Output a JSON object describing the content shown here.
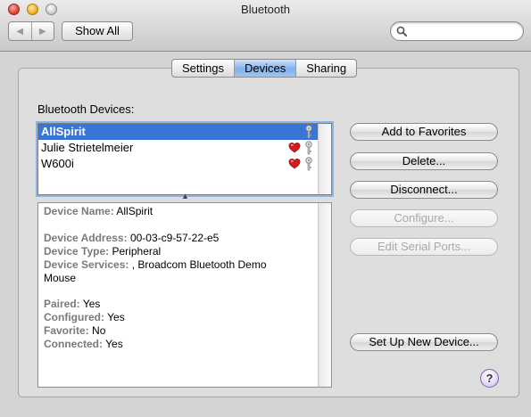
{
  "window": {
    "title": "Bluetooth"
  },
  "toolbar": {
    "back_glyph": "◀",
    "forward_glyph": "▶",
    "show_all_label": "Show All",
    "search": {
      "value": "",
      "placeholder": ""
    }
  },
  "tabs": [
    {
      "label": "Settings",
      "active": false
    },
    {
      "label": "Devices",
      "active": true
    },
    {
      "label": "Sharing",
      "active": false
    }
  ],
  "devices_label": "Bluetooth Devices:",
  "devices": [
    {
      "name": "AllSpirit",
      "selected": true,
      "favorite": false,
      "paired_key": true
    },
    {
      "name": "Julie Strietelmeier",
      "selected": false,
      "favorite": true,
      "paired_key": true
    },
    {
      "name": "W600i",
      "selected": false,
      "favorite": true,
      "paired_key": true
    }
  ],
  "split_glyph": "▲",
  "details": {
    "device_name": {
      "key": "Device Name:",
      "value": "AllSpirit"
    },
    "device_address": {
      "key": "Device Address:",
      "value": "00-03-c9-57-22-e5"
    },
    "device_type": {
      "key": "Device Type:",
      "value": "Peripheral"
    },
    "device_services": {
      "key": "Device Services:",
      "value": ", Broadcom Bluetooth Demo",
      "value2": "Mouse"
    },
    "paired": {
      "key": "Paired:",
      "value": "Yes"
    },
    "configured": {
      "key": "Configured:",
      "value": "Yes"
    },
    "favorite": {
      "key": "Favorite:",
      "value": "No"
    },
    "connected": {
      "key": "Connected:",
      "value": "Yes"
    }
  },
  "buttons": {
    "add_favorites": "Add to Favorites",
    "delete": "Delete...",
    "disconnect": "Disconnect...",
    "configure": "Configure...",
    "edit_serial": "Edit Serial Ports...",
    "setup_new": "Set Up New Device..."
  },
  "help_label": "?",
  "colors": {
    "selection": "#3875d7",
    "active_tab": "#7fb1ec",
    "heart": "#d41a1a"
  }
}
